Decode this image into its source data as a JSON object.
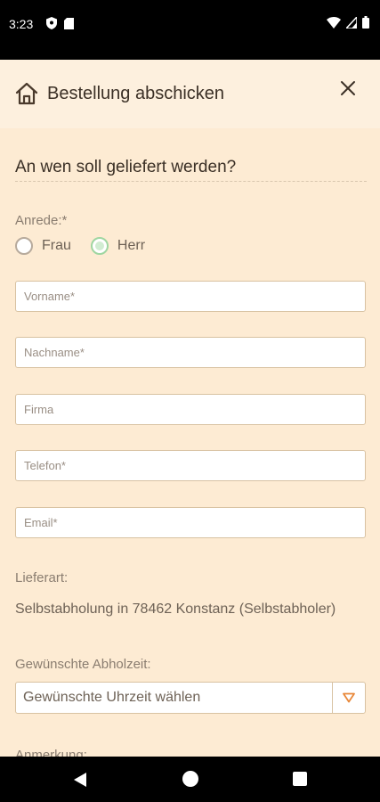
{
  "status_bar": {
    "time": "3:23",
    "icons": [
      "shield-icon",
      "sd-card-icon",
      "wifi-icon",
      "signal-icon",
      "battery-icon"
    ]
  },
  "header": {
    "title": "Bestellung abschicken",
    "icon": "home-icon",
    "close_icon": "close-icon"
  },
  "form": {
    "section_title": "An wen soll geliefert werden?",
    "salutation": {
      "label": "Anrede:*",
      "options": [
        {
          "label": "Frau",
          "selected": false
        },
        {
          "label": "Herr",
          "selected": true
        }
      ]
    },
    "fields": {
      "first_name": {
        "placeholder": "Vorname*",
        "value": ""
      },
      "last_name": {
        "placeholder": "Nachname*",
        "value": ""
      },
      "company": {
        "placeholder": "Firma",
        "value": ""
      },
      "phone": {
        "placeholder": "Telefon*",
        "value": ""
      },
      "email": {
        "placeholder": "Email*",
        "value": ""
      }
    },
    "delivery": {
      "label": "Lieferart:",
      "value": "Selbstabholung in 78462 Konstanz (Selbstabholer)"
    },
    "pickup_time": {
      "label": "Gewünschte Abholzeit:",
      "selected": "Gewünschte Uhrzeit wählen"
    },
    "note_label": "Anmerkung:"
  },
  "colors": {
    "background": "#fdebd3",
    "header_bg": "#fdf0de",
    "accent_green": "#9fd6a1",
    "accent_orange": "#e8883a",
    "border": "#d8c2a2"
  }
}
